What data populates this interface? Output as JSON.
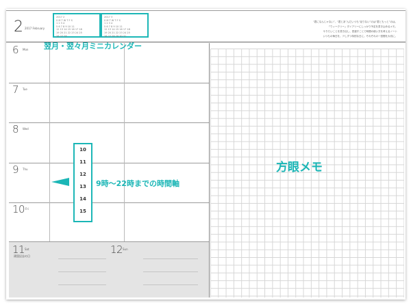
{
  "header": {
    "month_number": "2",
    "month_label": "2017 February",
    "mini_calendars": [
      {
        "title": "2017  2",
        "rows": [
          "S  M  T  W  T  F  S",
          "          1   2   3   4",
          "5   6   7   8   9  10 11",
          "12 13 14 15 16 17 18",
          "19 20 21 22 23 24 25",
          "26 27 28"
        ]
      },
      {
        "title": "2017  3",
        "rows": [
          "S  M  T  W  T  F  S",
          "          1   2   3   4",
          "5   6   7   8   9  10 11",
          "12 13 14 15 16 17 18",
          "19 20 21 22 23 24 25",
          "26 27 28 29 30 31"
        ]
      }
    ],
    "quote_lines": [
      "“君になんじゃない”、“君とあ”んだいつも“足りない”のは“君ともっと”のは。",
      "「ウィークリー」ダイアリーにしっかり予定を書き込めるメモ。",
      "やりたいことを書き出し、見渡すことで時間の使い方を考えるノート",
      "いつもの毎日を、少しずつ特別な日に。それぞれの一週間を大切に。"
    ]
  },
  "days": [
    {
      "num": "6",
      "label": "Mon"
    },
    {
      "num": "7",
      "label": "Tue"
    },
    {
      "num": "8",
      "label": "Wed"
    },
    {
      "num": "9",
      "label": "Thu"
    },
    {
      "num": "10",
      "label": "Fri"
    }
  ],
  "weekend": [
    {
      "num": "11",
      "label": "Sat",
      "sub": "建国記念の日"
    },
    {
      "num": "12",
      "label": "Sun"
    }
  ],
  "time_axis": [
    "10",
    "11",
    "12",
    "13",
    "14",
    "15"
  ],
  "annotations": {
    "mini_calendar": "翌月・翌々月ミニカレンダー",
    "time_axis": "9時〜22時までの時間軸",
    "grid_memo": "方眼メモ"
  },
  "colors": {
    "accent": "#1bb6b6",
    "weekend_bg": "#e4e4e4",
    "grid_line": "#d6d6d6"
  }
}
